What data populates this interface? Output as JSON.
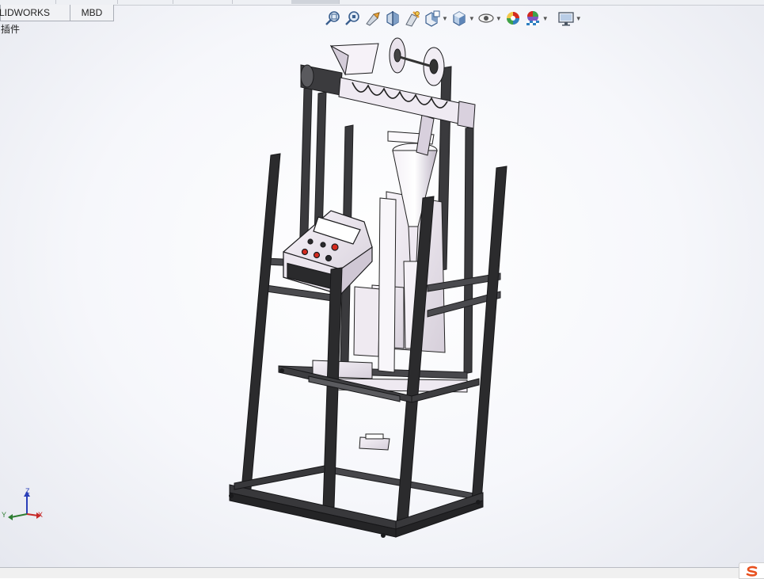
{
  "tabs": [
    {
      "label": "LIDWORKS 插件"
    },
    {
      "label": "MBD"
    }
  ],
  "heads_up_toolbar": [
    {
      "icon": "zoom-to-fit-icon",
      "has_menu": false
    },
    {
      "icon": "zoom-to-area-icon",
      "has_menu": false
    },
    {
      "icon": "previous-view-icon",
      "has_menu": false
    },
    {
      "icon": "section-view-icon",
      "has_menu": false
    },
    {
      "icon": "dynamic-annotation-icon",
      "has_menu": false
    },
    {
      "icon": "view-orientation-icon",
      "has_menu": true
    },
    {
      "icon": "display-style-icon",
      "has_menu": true
    },
    {
      "icon": "hide-show-items-icon",
      "has_menu": true
    },
    {
      "icon": "edit-appearance-icon",
      "has_menu": false
    },
    {
      "icon": "apply-scene-icon",
      "has_menu": true
    },
    {
      "icon": "view-settings-icon",
      "has_menu": true
    }
  ],
  "triad": {
    "x": "X",
    "y": "Y",
    "z": "Z"
  },
  "colors": {
    "frame": "#2b2b2d",
    "part": "#ebe6ee",
    "accent_red": "#d42a1e",
    "logo": "#e8501e"
  }
}
